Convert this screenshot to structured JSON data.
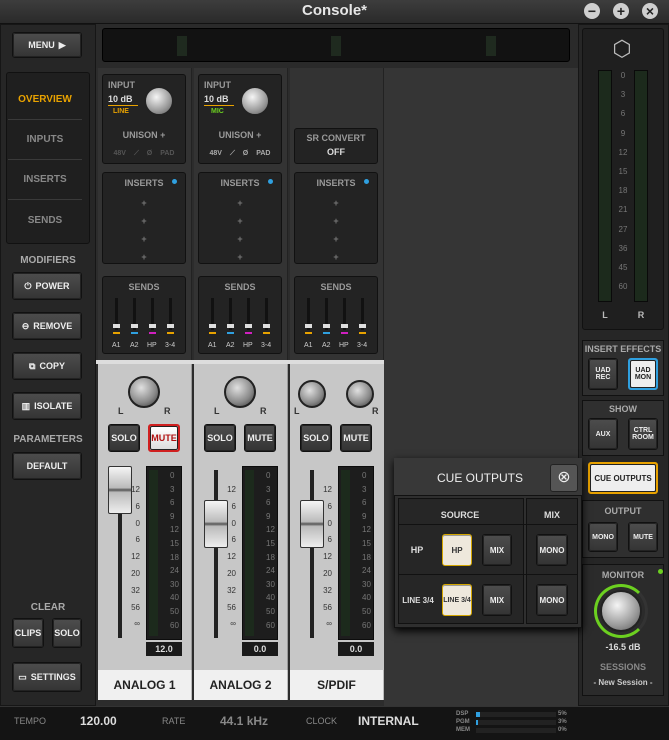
{
  "window": {
    "title": "Console*",
    "min": "−",
    "max": "+",
    "close": "×"
  },
  "left": {
    "menu": "MENU",
    "nav": [
      "OVERVIEW",
      "INPUTS",
      "INSERTS",
      "SENDS"
    ],
    "modifiers": {
      "title": "MODIFIERS",
      "items": [
        "POWER",
        "REMOVE",
        "COPY",
        "ISOLATE"
      ]
    },
    "parameters": {
      "title": "PARAMETERS",
      "default": "DEFAULT"
    },
    "clear": {
      "title": "CLEAR",
      "clips": "CLIPS",
      "solo": "SOLO"
    },
    "settings": "SETTINGS"
  },
  "channels": [
    {
      "name": "ANALOG 1",
      "input_label": "INPUT",
      "gain": "10 dB",
      "type": "LINE",
      "unison": "UNISON +",
      "opts": [
        "48V",
        "⟋",
        "Ø",
        "PAD"
      ],
      "inserts": "INSERTS",
      "sends": "SENDS",
      "send_labels": [
        "A1",
        "A2",
        "HP",
        "3-4"
      ],
      "solo": "SOLO",
      "mute": "MUTE",
      "fader_value": "12.0",
      "muted": true
    },
    {
      "name": "ANALOG 2",
      "input_label": "INPUT",
      "gain": "10 dB",
      "type": "MIC",
      "unison": "UNISON +",
      "opts": [
        "48V",
        "⟋",
        "Ø",
        "PAD"
      ],
      "inserts": "INSERTS",
      "sends": "SENDS",
      "send_labels": [
        "A1",
        "A2",
        "HP",
        "3-4"
      ],
      "solo": "SOLO",
      "mute": "MUTE",
      "fader_value": "0.0",
      "muted": false
    },
    {
      "name": "S/PDIF",
      "sr_convert": "SR CONVERT",
      "sr_value": "OFF",
      "inserts": "INSERTS",
      "sends": "SENDS",
      "send_labels": [
        "A1",
        "A2",
        "HP",
        "3-4"
      ],
      "solo": "SOLO",
      "mute": "MUTE",
      "fader_value": "0.0",
      "muted": false
    }
  ],
  "pan": {
    "l": "L",
    "r": "R"
  },
  "fader_scale": [
    "12",
    "6",
    "0",
    "6",
    "12",
    "20",
    "32",
    "56",
    "∞"
  ],
  "meter_scale": [
    "0",
    "3",
    "6",
    "9",
    "12",
    "15",
    "18",
    "24",
    "30",
    "40",
    "50",
    "60"
  ],
  "right": {
    "master_scale": [
      "0",
      "3",
      "6",
      "9",
      "12",
      "15",
      "18",
      "21",
      "27",
      "36",
      "45",
      "60"
    ],
    "master_l": "L",
    "master_r": "R",
    "insert_effects": {
      "title": "INSERT EFFECTS",
      "rec": "UAD REC",
      "mon": "UAD MON"
    },
    "show": {
      "title": "SHOW",
      "aux": "AUX",
      "ctrl": "CTRL ROOM"
    },
    "cue_outputs": "CUE OUTPUTS",
    "output": {
      "title": "OUTPUT",
      "mono": "MONO",
      "mute": "MUTE"
    },
    "monitor": {
      "title": "MONITOR",
      "value": "-16.5 dB"
    },
    "sessions": {
      "title": "SESSIONS",
      "current": "- New Session -"
    }
  },
  "cue_popup": {
    "title": "CUE OUTPUTS",
    "source": "SOURCE",
    "mix": "MIX",
    "rows": [
      {
        "label": "HP",
        "src": "HP",
        "mix": "MIX",
        "mono": "MONO"
      },
      {
        "label": "LINE 3/4",
        "src": "LINE 3/4",
        "mix": "MIX",
        "mono": "MONO"
      }
    ]
  },
  "status": {
    "tempo_label": "TEMPO",
    "tempo": "120.00",
    "rate_label": "RATE",
    "rate": "44.1 kHz",
    "clock_label": "CLOCK",
    "clock": "INTERNAL",
    "dsp_label": "DSP",
    "dsp": "5%",
    "dsp_fill": 0.05,
    "pgm_label": "PGM",
    "pgm": "3%",
    "pgm_fill": 0.03,
    "mem_label": "MEM",
    "mem": "0%",
    "mem_fill": 0.0
  },
  "colors": {
    "accent": "#e8a200",
    "mute_red": "#d02020",
    "monitor_green": "#6cd020",
    "uad_blue": "#2fa0e0"
  }
}
